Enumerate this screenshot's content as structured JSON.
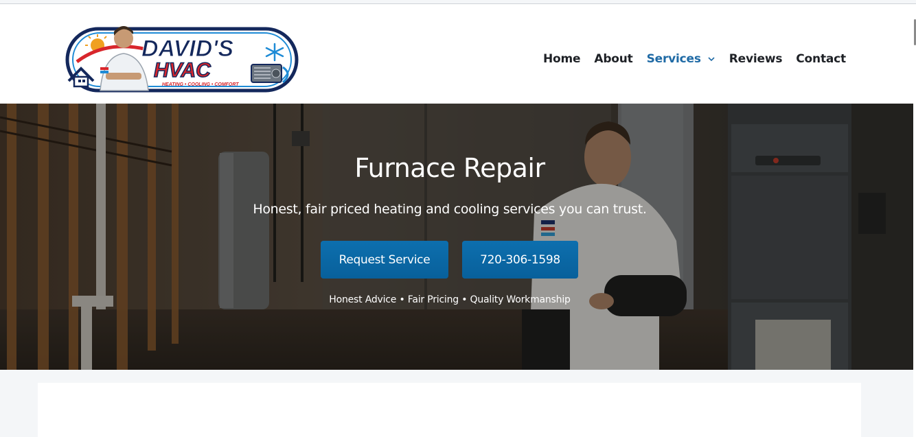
{
  "header": {
    "logo": {
      "name": "DAVID'S",
      "brand": "HVAC",
      "tagline": "HEATING • COOLING • COMFORT",
      "colors": {
        "navy": "#14285c",
        "red": "#d8262c",
        "sky": "#1e8bd6"
      }
    },
    "nav": [
      {
        "label": "Home",
        "active": false
      },
      {
        "label": "About",
        "active": false
      },
      {
        "label": "Services",
        "active": true,
        "has_dropdown": true
      },
      {
        "label": "Reviews",
        "active": false
      },
      {
        "label": "Contact",
        "active": false
      }
    ]
  },
  "hero": {
    "title": "Furnace Repair",
    "subtitle": "Honest, fair priced heating and cooling services you can trust.",
    "buttons": {
      "request": "Request Service",
      "phone": "720-306-1598"
    },
    "tagline": "Honest Advice • Fair Pricing • Quality Workmanship"
  },
  "colors": {
    "accent": "#1f6aa5",
    "button": "#0a67a6",
    "nav_text": "#1e2126",
    "page_bg": "#f4f6f8"
  }
}
